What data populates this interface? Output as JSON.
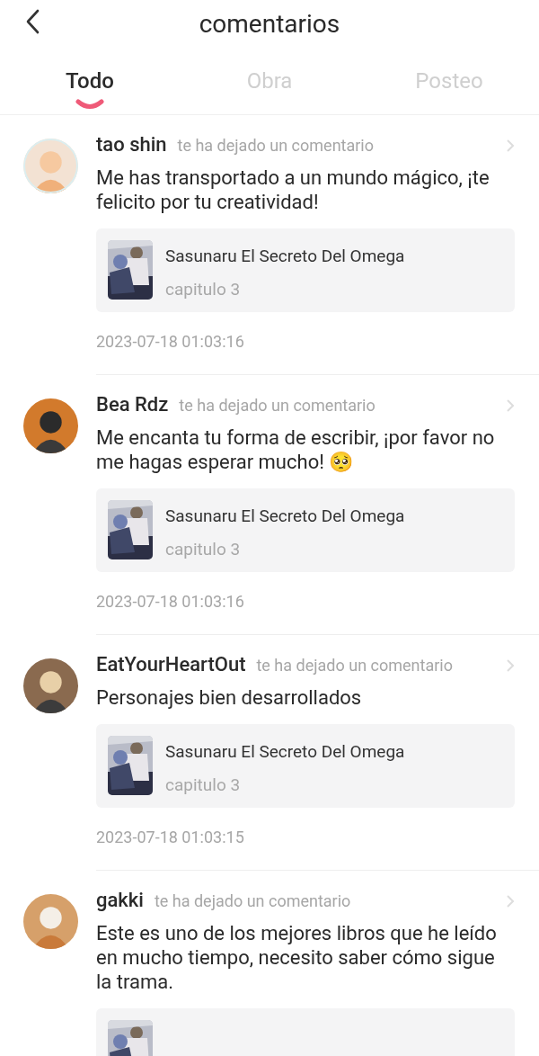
{
  "header": {
    "title": "comentarios"
  },
  "tabs": [
    {
      "label": "Todo",
      "selected": true
    },
    {
      "label": "Obra",
      "selected": false
    },
    {
      "label": "Posteo",
      "selected": false
    }
  ],
  "comments": [
    {
      "user": "tao shin",
      "action": "te ha dejado un comentario",
      "text": "Me has transportado a un mundo mágico, ¡te felicito por tu creatividad!",
      "work": {
        "title": "Sasunaru El Secreto Del Omega",
        "chapter": "capitulo 3"
      },
      "time": "2023-07-18 01:03:16"
    },
    {
      "user": "Bea Rdz",
      "action": "te ha dejado un comentario",
      "text": "Me encanta tu forma de escribir, ¡por favor no me hagas esperar mucho! 🥺",
      "work": {
        "title": "Sasunaru El Secreto Del Omega",
        "chapter": "capitulo 3"
      },
      "time": "2023-07-18 01:03:16"
    },
    {
      "user": "EatYourHeartOut",
      "action": "te ha dejado un comentario",
      "text": "Personajes bien desarrollados",
      "work": {
        "title": "Sasunaru El Secreto Del Omega",
        "chapter": "capitulo 3"
      },
      "time": "2023-07-18 01:03:15"
    },
    {
      "user": "gakki",
      "action": "te ha dejado un comentario",
      "text": "Este es uno de los mejores libros que he leído en mucho tiempo, necesito saber cómo sigue la trama."
    }
  ]
}
